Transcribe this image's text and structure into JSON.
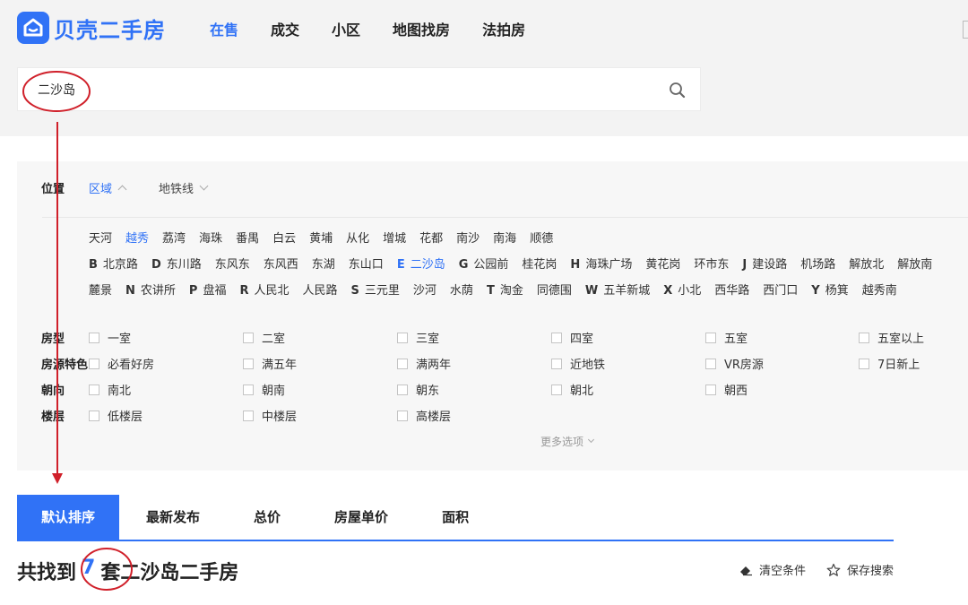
{
  "header": {
    "logo_text": "贝壳二手房",
    "nav": [
      "在售",
      "成交",
      "小区",
      "地图找房",
      "法拍房"
    ],
    "search": {
      "value": "二沙岛",
      "placeholder": ""
    }
  },
  "filters": {
    "position_label": "位置",
    "position_tabs": [
      "区域",
      "地铁线"
    ],
    "districts": [
      "天河",
      "越秀",
      "荔湾",
      "海珠",
      "番禺",
      "白云",
      "黄埔",
      "从化",
      "增城",
      "花都",
      "南沙",
      "南海",
      "顺德"
    ],
    "areas_row1": [
      {
        "letter": "B",
        "name": "北京路"
      },
      {
        "letter": "D",
        "name": "东川路"
      },
      {
        "letter": "",
        "name": "东风东"
      },
      {
        "letter": "",
        "name": "东风西"
      },
      {
        "letter": "",
        "name": "东湖"
      },
      {
        "letter": "",
        "name": "东山口"
      },
      {
        "letter": "E",
        "name": "二沙岛"
      },
      {
        "letter": "G",
        "name": "公园前"
      },
      {
        "letter": "",
        "name": "桂花岗"
      },
      {
        "letter": "H",
        "name": "海珠广场"
      },
      {
        "letter": "",
        "name": "黄花岗"
      },
      {
        "letter": "",
        "name": "环市东"
      },
      {
        "letter": "J",
        "name": "建设路"
      },
      {
        "letter": "",
        "name": "机场路"
      },
      {
        "letter": "",
        "name": "解放北"
      },
      {
        "letter": "",
        "name": "解放南"
      }
    ],
    "areas_row2": [
      {
        "letter": "",
        "name": "麓景"
      },
      {
        "letter": "N",
        "name": "农讲所"
      },
      {
        "letter": "P",
        "name": "盘福"
      },
      {
        "letter": "R",
        "name": "人民北"
      },
      {
        "letter": "",
        "name": "人民路"
      },
      {
        "letter": "S",
        "name": "三元里"
      },
      {
        "letter": "",
        "name": "沙河"
      },
      {
        "letter": "",
        "name": "水荫"
      },
      {
        "letter": "T",
        "name": "淘金"
      },
      {
        "letter": "",
        "name": "同德围"
      },
      {
        "letter": "W",
        "name": "五羊新城"
      },
      {
        "letter": "X",
        "name": "小北"
      },
      {
        "letter": "",
        "name": "西华路"
      },
      {
        "letter": "",
        "name": "西门口"
      },
      {
        "letter": "Y",
        "name": "杨箕"
      },
      {
        "letter": "",
        "name": "越秀南"
      }
    ],
    "rows": [
      {
        "label": "房型",
        "options": [
          "一室",
          "二室",
          "三室",
          "四室",
          "五室",
          "五室以上"
        ]
      },
      {
        "label": "房源特色",
        "options": [
          "必看好房",
          "满五年",
          "满两年",
          "近地铁",
          "VR房源",
          "7日新上"
        ]
      },
      {
        "label": "朝向",
        "options": [
          "南北",
          "朝南",
          "朝东",
          "朝北",
          "朝西"
        ]
      },
      {
        "label": "楼层",
        "options": [
          "低楼层",
          "中楼层",
          "高楼层"
        ]
      }
    ],
    "more_label": "更多选项"
  },
  "sort": {
    "tabs": [
      "默认排序",
      "最新发布",
      "总价",
      "房屋单价",
      "面积"
    ]
  },
  "result": {
    "prefix": "共找到",
    "count": "7",
    "suffix": "套",
    "query": "二沙岛二手房"
  },
  "tools": {
    "clear": "清空条件",
    "save": "保存搜索"
  },
  "colors": {
    "brand": "#3072f6",
    "annotation": "#d0202a"
  }
}
